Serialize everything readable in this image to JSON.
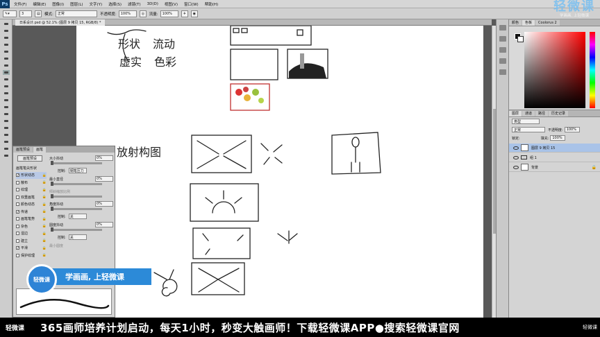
{
  "app": {
    "logo": "Ps"
  },
  "menubar": {
    "items": [
      "文件(F)",
      "编辑(E)",
      "图像(I)",
      "图层(L)",
      "文字(Y)",
      "选择(S)",
      "滤镜(T)",
      "3D(D)",
      "视图(V)",
      "窗口(W)",
      "帮助(H)"
    ]
  },
  "options": {
    "size": "3",
    "mode_label": "模式:",
    "mode_value": "正常",
    "opacity_label": "不透明度:",
    "opacity_value": "100%",
    "flow_label": "流量:",
    "flow_value": "100%"
  },
  "document": {
    "tab": "日系设计.psd @ 52.1% (图层 9 拷贝 15, RGB/8) *"
  },
  "color_panel": {
    "tabs": [
      "颜色",
      "色板",
      "Coolorus 2"
    ]
  },
  "layers_panel": {
    "tabs": [
      "图层",
      "通道",
      "路径",
      "历史记录"
    ],
    "kind_label": "类型",
    "blend": "正常",
    "opacity_label": "不透明度:",
    "opacity_value": "100%",
    "lock_label": "锁定:",
    "fill_label": "填充:",
    "fill_value": "100%",
    "layers": [
      {
        "name": "图层 9 拷贝 15",
        "type": "layer",
        "selected": true
      },
      {
        "name": "组 1",
        "type": "group",
        "selected": false
      },
      {
        "name": "背景",
        "type": "background",
        "selected": false
      }
    ]
  },
  "brush_panel": {
    "tabs": [
      "画笔预设",
      "画笔"
    ],
    "presets_button": "画笔预设",
    "items": [
      {
        "label": "画笔笔尖形状",
        "checked": false,
        "selected": false
      },
      {
        "label": "形状动态",
        "checked": true,
        "selected": true
      },
      {
        "label": "散布",
        "checked": false,
        "selected": false
      },
      {
        "label": "纹理",
        "checked": false,
        "selected": false
      },
      {
        "label": "双重画笔",
        "checked": false,
        "selected": false
      },
      {
        "label": "颜色动态",
        "checked": false,
        "selected": false
      },
      {
        "label": "传递",
        "checked": true,
        "selected": false
      },
      {
        "label": "画笔笔势",
        "checked": false,
        "selected": false
      },
      {
        "label": "杂色",
        "checked": false,
        "selected": false
      },
      {
        "label": "湿边",
        "checked": false,
        "selected": false
      },
      {
        "label": "建立",
        "checked": false,
        "selected": false
      },
      {
        "label": "平滑",
        "checked": true,
        "selected": false
      },
      {
        "label": "保护纹理",
        "checked": false,
        "selected": false
      }
    ],
    "size_jitter_label": "大小抖动",
    "size_jitter_value": "0%",
    "control_label": "控制:",
    "control_value_1": "钢笔压力",
    "min_diameter_label": "最小直径",
    "min_diameter_value": "0%",
    "tilt_scale_label": "倾斜缩放比例",
    "angle_jitter_label": "角度抖动",
    "angle_jitter_value": "0%",
    "control_value_2": "关",
    "roundness_jitter_label": "圆度抖动",
    "roundness_jitter_value": "0%",
    "control_value_3": "关",
    "min_roundness_label": "最小圆度"
  },
  "canvas": {
    "text_shape": "形状",
    "text_stream": "流动",
    "text_virtual": "虚实",
    "text_color": "色彩",
    "text_radial": "放射构图"
  },
  "badge": {
    "logo": "轻微课",
    "slogan": "学画画, 上轻微课"
  },
  "watermark": {
    "brand": "轻微课",
    "tagline": "学画画, 上轻微课"
  },
  "footer": {
    "logo": "轻微课",
    "text": "365画师培养计划启动，每天1小时，秒变大触画师！下载轻微课APP●搜索轻微课官网",
    "right_logo": "轻微课"
  }
}
